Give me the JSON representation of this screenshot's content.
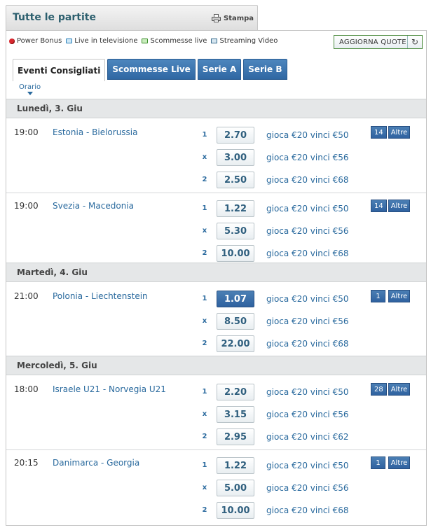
{
  "header": {
    "title": "Tutte le partite",
    "print_label": "Stampa"
  },
  "legend": [
    {
      "label": "Power Bonus",
      "icon": "power-bonus-icon"
    },
    {
      "label": "Live in televisione",
      "icon": "tv-icon"
    },
    {
      "label": "Scommesse live",
      "icon": "live-bet-icon"
    },
    {
      "label": "Streaming Video",
      "icon": "streaming-icon"
    }
  ],
  "refresh_label": "AGGIORNA QUOTE",
  "tabs": [
    {
      "label": "Eventi Consigliati",
      "active": true
    },
    {
      "label": "Scommesse Live",
      "active": false
    },
    {
      "label": "Serie A",
      "active": false
    },
    {
      "label": "Serie B",
      "active": false
    }
  ],
  "sort_label": "Orario",
  "more_label": "Altre",
  "days": [
    {
      "label": "Lunedì, 3. Giu",
      "events": [
        {
          "time": "19:00",
          "name": "Estonia - Bielorussia",
          "count": "14",
          "selections": [
            {
              "label": "1",
              "odd": "2.70",
              "payout": "gioca €20 vinci €50"
            },
            {
              "label": "x",
              "odd": "3.00",
              "payout": "gioca €20 vinci €56"
            },
            {
              "label": "2",
              "odd": "2.50",
              "payout": "gioca €20 vinci €68"
            }
          ]
        },
        {
          "time": "19:00",
          "name": "Svezia - Macedonia",
          "count": "14",
          "selections": [
            {
              "label": "1",
              "odd": "1.22",
              "payout": "gioca €20 vinci €50"
            },
            {
              "label": "x",
              "odd": "5.30",
              "payout": "gioca €20 vinci €56"
            },
            {
              "label": "2",
              "odd": "10.00",
              "payout": "gioca €20 vinci €68"
            }
          ]
        }
      ]
    },
    {
      "label": "Martedì, 4. Giu",
      "events": [
        {
          "time": "21:00",
          "name": "Polonia - Liechtenstein",
          "count": "1",
          "selections": [
            {
              "label": "1",
              "odd": "1.07",
              "payout": "gioca €20 vinci €50",
              "selected": true
            },
            {
              "label": "x",
              "odd": "8.50",
              "payout": "gioca €20 vinci €56"
            },
            {
              "label": "2",
              "odd": "22.00",
              "payout": "gioca €20 vinci €68"
            }
          ]
        }
      ]
    },
    {
      "label": "Mercoledì, 5. Giu",
      "events": [
        {
          "time": "18:00",
          "name": "Israele U21 - Norvegia U21",
          "count": "28",
          "selections": [
            {
              "label": "1",
              "odd": "2.20",
              "payout": "gioca €20 vinci €50"
            },
            {
              "label": "x",
              "odd": "3.15",
              "payout": "gioca €20 vinci €56"
            },
            {
              "label": "2",
              "odd": "2.95",
              "payout": "gioca €20 vinci €62"
            }
          ]
        },
        {
          "time": "20:15",
          "name": "Danimarca - Georgia",
          "count": "1",
          "selections": [
            {
              "label": "1",
              "odd": "1.22",
              "payout": "gioca €20 vinci €50"
            },
            {
              "label": "x",
              "odd": "5.00",
              "payout": "gioca €20 vinci €56"
            },
            {
              "label": "2",
              "odd": "10.00",
              "payout": "gioca €20 vinci €68"
            }
          ]
        }
      ]
    }
  ]
}
